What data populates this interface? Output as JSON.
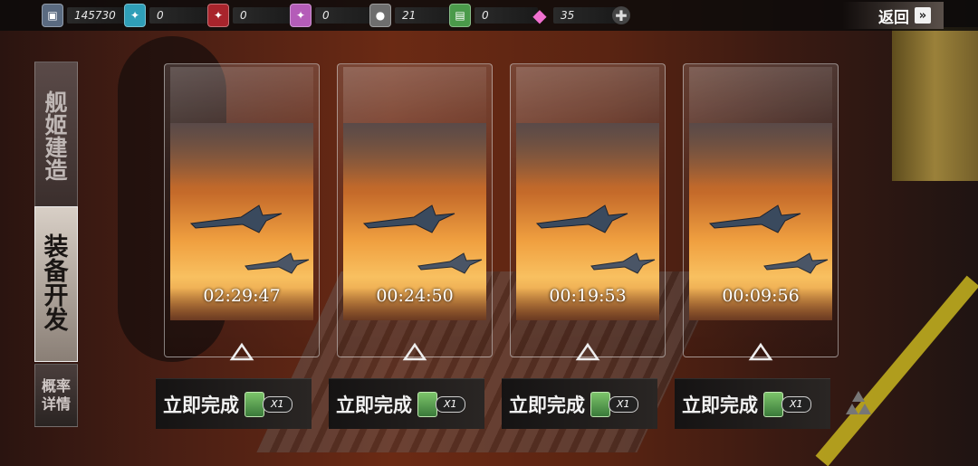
{
  "resources": [
    {
      "icon": "gear-crate-icon",
      "value": "145730",
      "color": "#8aa4c8"
    },
    {
      "icon": "blue-blueprint-icon",
      "value": "0",
      "color": "#4fc3d9"
    },
    {
      "icon": "red-blueprint-icon",
      "value": "0",
      "color": "#c8323a"
    },
    {
      "icon": "pink-blueprint-icon",
      "value": "0",
      "color": "#d678d8"
    },
    {
      "icon": "silver-medal-icon",
      "value": "21",
      "color": "#9a9a9a"
    },
    {
      "icon": "green-ticket-icon",
      "value": "0",
      "color": "#5aa85a"
    },
    {
      "icon": "diamond-icon",
      "value": "35",
      "color": "#e860c0"
    }
  ],
  "back_label": "返回",
  "tabs": [
    {
      "label": [
        "舰",
        "姬",
        "建",
        "造"
      ],
      "active": false
    },
    {
      "label": [
        "装",
        "备",
        "开",
        "发"
      ],
      "active": true
    },
    {
      "label": [
        "概率",
        "详情"
      ],
      "active": false
    }
  ],
  "slots": [
    {
      "timer": "02:29:47",
      "finish_label": "立即完成",
      "cost": "X1"
    },
    {
      "timer": "00:24:50",
      "finish_label": "立即完成",
      "cost": "X1"
    },
    {
      "timer": "00:19:53",
      "finish_label": "立即完成",
      "cost": "X1"
    },
    {
      "timer": "00:09:56",
      "finish_label": "立即完成",
      "cost": "X1"
    }
  ]
}
